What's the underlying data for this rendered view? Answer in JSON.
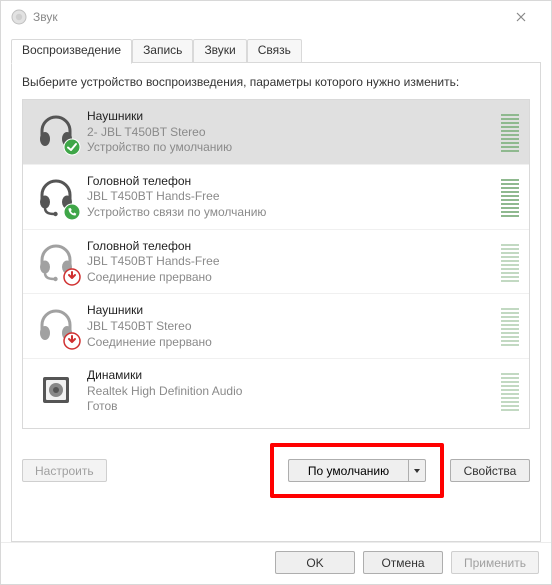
{
  "window": {
    "title": "Звук"
  },
  "tabs": [
    {
      "label": "Воспроизведение"
    },
    {
      "label": "Запись"
    },
    {
      "label": "Звуки"
    },
    {
      "label": "Связь"
    }
  ],
  "intro": "Выберите устройство воспроизведения, параметры которого нужно изменить:",
  "devices": [
    {
      "name": "Наушники",
      "sub": "2- JBL T450BT Stereo",
      "status": "Устройство по умолчанию",
      "icon": "headphones",
      "badge": "check",
      "selected": true,
      "meter": "full"
    },
    {
      "name": "Головной телефон",
      "sub": "JBL T450BT Hands-Free",
      "status": "Устройство связи по умолчанию",
      "icon": "headset",
      "badge": "phone",
      "selected": false,
      "meter": "full"
    },
    {
      "name": "Головной телефон",
      "sub": "JBL T450BT Hands-Free",
      "status": "Соединение прервано",
      "icon": "headset",
      "badge": "down",
      "selected": false,
      "meter": "dim"
    },
    {
      "name": "Наушники",
      "sub": "JBL T450BT Stereo",
      "status": "Соединение прервано",
      "icon": "headphones",
      "badge": "down",
      "selected": false,
      "meter": "dim"
    },
    {
      "name": "Динамики",
      "sub": "Realtek High Definition Audio",
      "status": "Готов",
      "icon": "speaker",
      "badge": "none",
      "selected": false,
      "meter": "dim"
    }
  ],
  "buttons": {
    "configure": "Настроить",
    "set_default": "По умолчанию",
    "properties": "Свойства",
    "ok": "OK",
    "cancel": "Отмена",
    "apply": "Применить"
  }
}
